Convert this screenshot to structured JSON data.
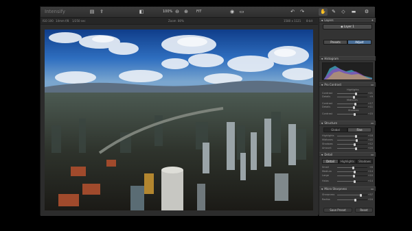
{
  "app": {
    "title": "Intensify"
  },
  "toolbar": {
    "zoom_label": "100%",
    "fit_label": "FIT",
    "icons": [
      "open-icon",
      "export-icon",
      "compare-icon",
      "zoom-out-icon",
      "zoom-in-icon",
      "zoom-fit-icon",
      "preview-eye-icon",
      "undo-icon",
      "redo-icon",
      "hand-icon",
      "brush-icon",
      "eraser-icon",
      "mask-icon",
      "settings-icon"
    ]
  },
  "infobar": {
    "iso": "ISO 100",
    "focal": "14mm",
    "aperture": "f/8",
    "shutter": "1/250 sec",
    "zoom_label": "Zoom",
    "zoom_value": "80%",
    "dimensions": "1580 x 1121",
    "bit_depth": "8-bit"
  },
  "panel": {
    "layers_title": "Layers",
    "layer_name": "Layer 1",
    "tabs": {
      "presets": "Presets",
      "adjust": "Adjust"
    },
    "histogram_title": "Histogram",
    "pro_contrast": {
      "title": "Pro Contrast",
      "highlights_title": "Highlights",
      "midtones_title": "Midtones",
      "shadows_title": "Shadows",
      "rows": [
        {
          "label": "Contrast",
          "value": "+21",
          "level": 0.62
        },
        {
          "label": "Details",
          "value": "+9",
          "level": 0.55
        },
        {
          "label": "Contrast",
          "value": "+17",
          "level": 0.6
        },
        {
          "label": "Details",
          "value": "+11",
          "level": 0.56
        },
        {
          "label": "Contrast",
          "value": "+15",
          "level": 0.58
        }
      ]
    },
    "structure": {
      "title": "Structure",
      "seg": [
        "Global",
        "Fine"
      ],
      "rows": [
        {
          "label": "Highlights",
          "value": "+18",
          "level": 0.62
        },
        {
          "label": "Midtones",
          "value": "+22",
          "level": 0.64
        },
        {
          "label": "Shadows",
          "value": "+12",
          "level": 0.58
        },
        {
          "label": "Amount",
          "value": "+20",
          "level": 0.63
        }
      ]
    },
    "detail": {
      "title": "Detail",
      "seg": [
        "Detail",
        "Highlights",
        "Shadows"
      ],
      "rows": [
        {
          "label": "Small",
          "value": "+6",
          "level": 0.54
        },
        {
          "label": "Medium",
          "value": "+14",
          "level": 0.58
        },
        {
          "label": "Large",
          "value": "+10",
          "level": 0.56
        },
        {
          "label": "Halos",
          "value": "+14",
          "level": 0.58
        }
      ]
    },
    "micro_sharpness": {
      "title": "Micro Sharpness",
      "rows": [
        {
          "label": "Sharpness",
          "value": "+57",
          "level": 0.78
        },
        {
          "label": "Radius",
          "value": "+24",
          "level": 0.6
        }
      ]
    },
    "bottom": {
      "presets_button": "Save Preset",
      "reset_button": "Reset"
    },
    "colors": {
      "accent": "#4a86c8",
      "panel_bg": "#333333",
      "header_bg": "#3a3a3a"
    }
  }
}
